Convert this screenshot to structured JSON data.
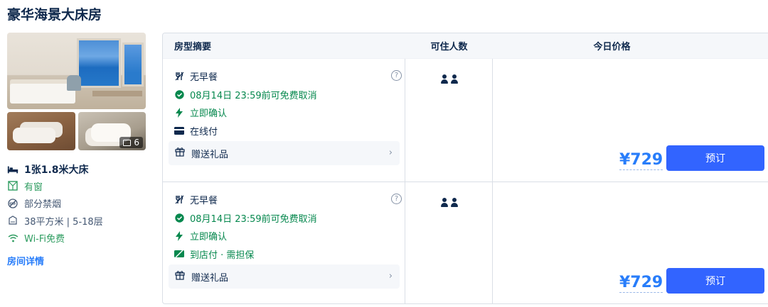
{
  "room": {
    "title": "豪华海景大床房",
    "photo_count": "6",
    "bed": "1张1.8米大床",
    "features": [
      {
        "icon": "window-icon",
        "text": "有窗"
      },
      {
        "icon": "no-smoking-icon",
        "text": "部分禁烟"
      },
      {
        "icon": "room-size-icon",
        "text": "38平方米 | 5-18层"
      },
      {
        "icon": "wifi-icon",
        "text": "Wi-Fi免费"
      }
    ],
    "detail_link": "房间详情"
  },
  "table": {
    "headers": {
      "summary": "房型摘要",
      "occupancy": "可住人数",
      "price": "今日价格"
    },
    "rows": [
      {
        "meal": "无早餐",
        "cancel": "08月14日 23:59前可免费取消",
        "confirm": "立即确认",
        "payment": "在线付",
        "gift": "赠送礼品",
        "price": "¥729",
        "book": "预订"
      },
      {
        "meal": "无早餐",
        "cancel": "08月14日 23:59前可免费取消",
        "confirm": "立即确认",
        "payment": "到店付 · 需担保",
        "gift": "赠送礼品",
        "price": "¥729",
        "book": "预订"
      }
    ]
  },
  "colors": {
    "primary": "#287dfa",
    "button": "#3264ff",
    "green": "#06884e",
    "text": "#0f294d"
  }
}
